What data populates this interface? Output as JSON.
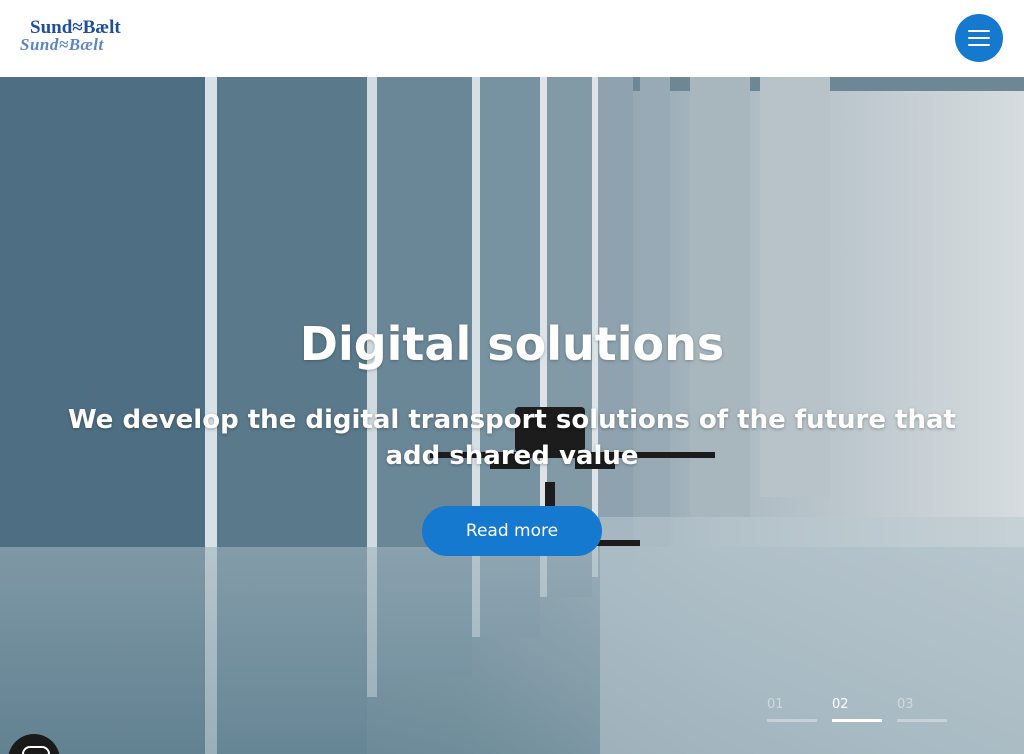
{
  "header": {
    "logo_top": "Sund≈Bælt",
    "logo_bottom": "Sund≈Bælt",
    "menu_icon": "hamburger-menu-icon"
  },
  "hero": {
    "title": "Digital solutions",
    "subtitle": "We develop the digital transport solutions of the future that add shared value",
    "cta_label": "Read more"
  },
  "slides": [
    {
      "number": "01",
      "active": false
    },
    {
      "number": "02",
      "active": true
    },
    {
      "number": "03",
      "active": false
    }
  ],
  "chat": {
    "icon": "chat-icon"
  },
  "colors": {
    "brand_blue": "#1479cf",
    "logo_blue": "#1f4f9a",
    "white": "#ffffff"
  }
}
